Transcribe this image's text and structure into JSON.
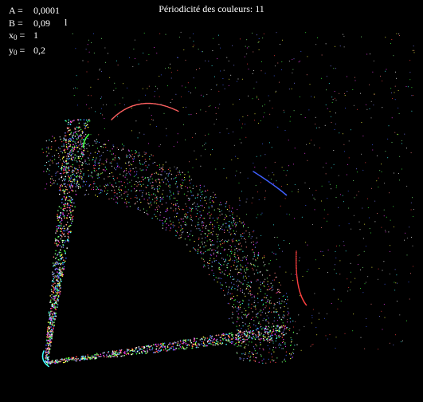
{
  "window": {
    "title": "Périodicité des couleurs: 11"
  },
  "parameters": [
    {
      "name": "A",
      "sub": "",
      "value": "0,0001"
    },
    {
      "name": "B",
      "sub": "",
      "value": "0,09"
    },
    {
      "name": "x",
      "sub": "0",
      "value": "1"
    },
    {
      "name": "y",
      "sub": "0",
      "value": "0,2"
    }
  ],
  "cursor_glyph": "l",
  "colors": {
    "background": "#000000",
    "text": "#ffffff",
    "palette": [
      "#ff4040",
      "#40ff40",
      "#4060ff",
      "#ff40ff",
      "#40ffff",
      "#ffff40",
      "#ffffff",
      "#ff8080",
      "#80ff80",
      "#8080ff",
      "#c0c0c0"
    ]
  }
}
